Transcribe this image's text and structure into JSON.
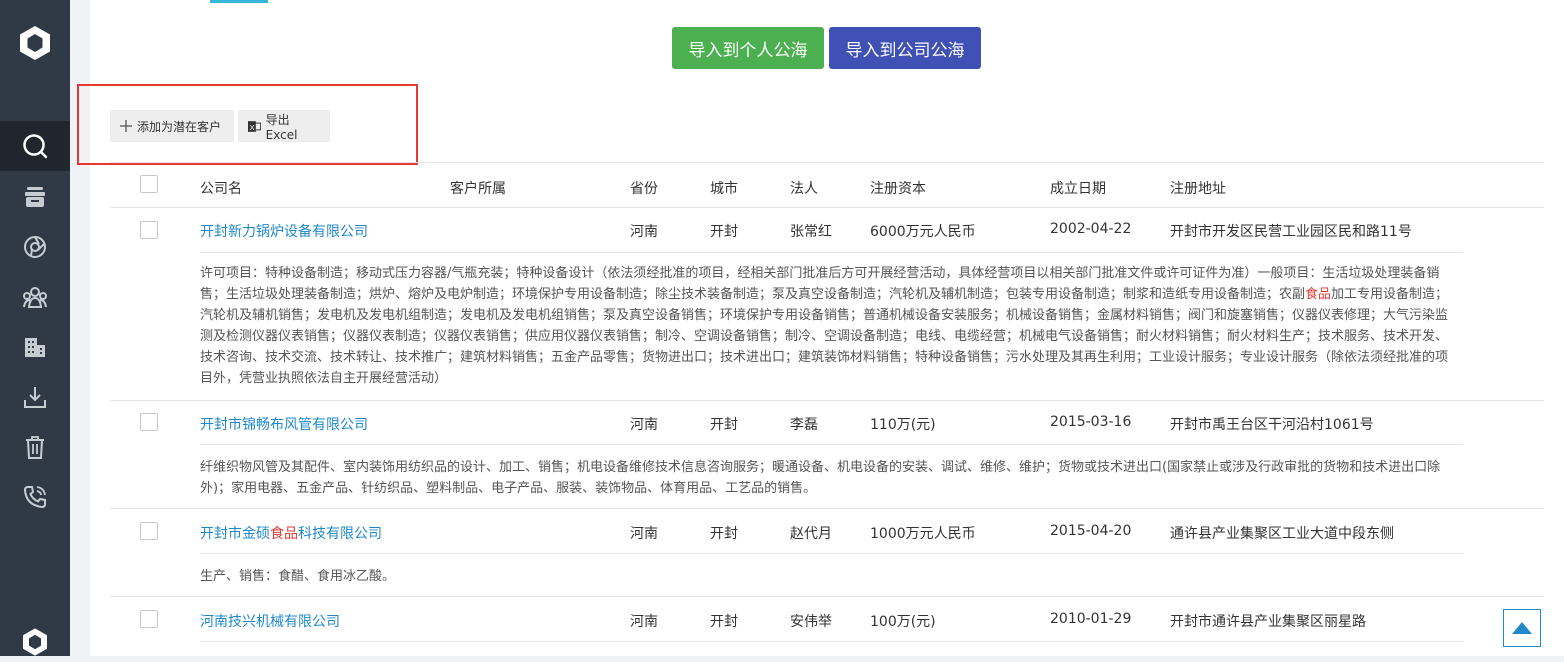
{
  "toolbar": {
    "import_personal": "导入到个人公海",
    "import_company": "导入到公司公海",
    "add_potential": "添加为潜在客户",
    "export_excel": "导出Excel"
  },
  "table": {
    "headers": {
      "company": "公司名",
      "owner": "客户所属",
      "province": "省份",
      "city": "城市",
      "legal": "法人",
      "capital": "注册资本",
      "date": "成立日期",
      "address": "注册地址"
    },
    "rows": [
      {
        "company_parts": [
          "开封新力锅炉设备有限公司"
        ],
        "province": "河南",
        "city": "开封",
        "legal": "张常红",
        "capital": "6000万元人民币",
        "date": "2002-04-22",
        "address": "开封市开发区民营工业园区民和路11号",
        "desc_parts": [
          "许可项目：特种设备制造；移动式压力容器/气瓶充装；特种设备设计（依法须经批准的项目，经相关部门批准后方可开展经营活动，具体经营项目以相关部门批准文件或许可证件为准）一般项目：生活垃圾处理装备销售；生活垃圾处理装备制造；烘炉、熔炉及电炉制造；环境保护专用设备制造；除尘技术装备制造；泵及真空设备制造；汽轮机及辅机制造；包装专用设备制造；制浆和造纸专用设备制造；农副",
          "食品",
          "加工专用设备制造；汽轮机及辅机销售；发电机及发电机组制造；发电机及发电机组销售；泵及真空设备销售；环境保护专用设备销售；普通机械设备安装服务；机械设备销售；金属材料销售；阀门和旋塞销售；仪器仪表修理；大气污染监测及检测仪器仪表销售；仪器仪表制造；仪器仪表销售；供应用仪器仪表销售；制冷、空调设备销售；制冷、空调设备制造；电线、电缆经营；机械电气设备销售；耐火材料销售；耐火材料生产；技术服务、技术开发、技术咨询、技术交流、技术转让、技术推广；建筑材料销售；五金产品零售；货物进出口；技术进出口；建筑装饰材料销售；特种设备销售；污水处理及其再生利用；工业设计服务；专业设计服务（除依法须经批准的项目外，凭营业执照依法自主开展经营活动）"
        ]
      },
      {
        "company_parts": [
          "开封市锦畅布风管有限公司"
        ],
        "province": "河南",
        "city": "开封",
        "legal": "李磊",
        "capital": "110万(元)",
        "date": "2015-03-16",
        "address": "开封市禹王台区干河沿村1061号",
        "desc_parts": [
          "纤维织物风管及其配件、室内装饰用纺织品的设计、加工、销售；机电设备维修技术信息咨询服务；暖通设备、机电设备的安装、调试、维修、维护；货物或技术进出口(国家禁止或涉及行政审批的货物和技术进出口除外)；家用电器、五金产品、针纺织品、塑料制品、电子产品、服装、装饰物品、体育用品、工艺品的销售。"
        ]
      },
      {
        "company_parts": [
          "开封市金硕",
          "食品",
          "科技有限公司"
        ],
        "province": "河南",
        "city": "开封",
        "legal": "赵代月",
        "capital": "1000万元人民币",
        "date": "2015-04-20",
        "address": "通许县产业集聚区工业大道中段东侧",
        "desc_parts": [
          "生产、销售：食醋、食用冰乙酸。"
        ]
      },
      {
        "company_parts": [
          "河南技兴机械有限公司"
        ],
        "province": "河南",
        "city": "开封",
        "legal": "安伟举",
        "capital": "100万(元)",
        "date": "2010-01-29",
        "address": "开封市通许县产业集聚区丽星路",
        "desc_parts": []
      }
    ]
  },
  "icons": {
    "logo": "hexagon-logo-icon",
    "nav": [
      "search-icon",
      "database-icon",
      "aperture-icon",
      "team-icon",
      "building-icon",
      "download-icon",
      "trash-icon",
      "phone-icon"
    ],
    "scroll_top": "arrow-up-icon"
  },
  "colors": {
    "sidebar": "#2f3a46",
    "green": "#4caf50",
    "blue": "#3f51b5",
    "link": "#1e88c8",
    "highlight": "#e53935"
  }
}
